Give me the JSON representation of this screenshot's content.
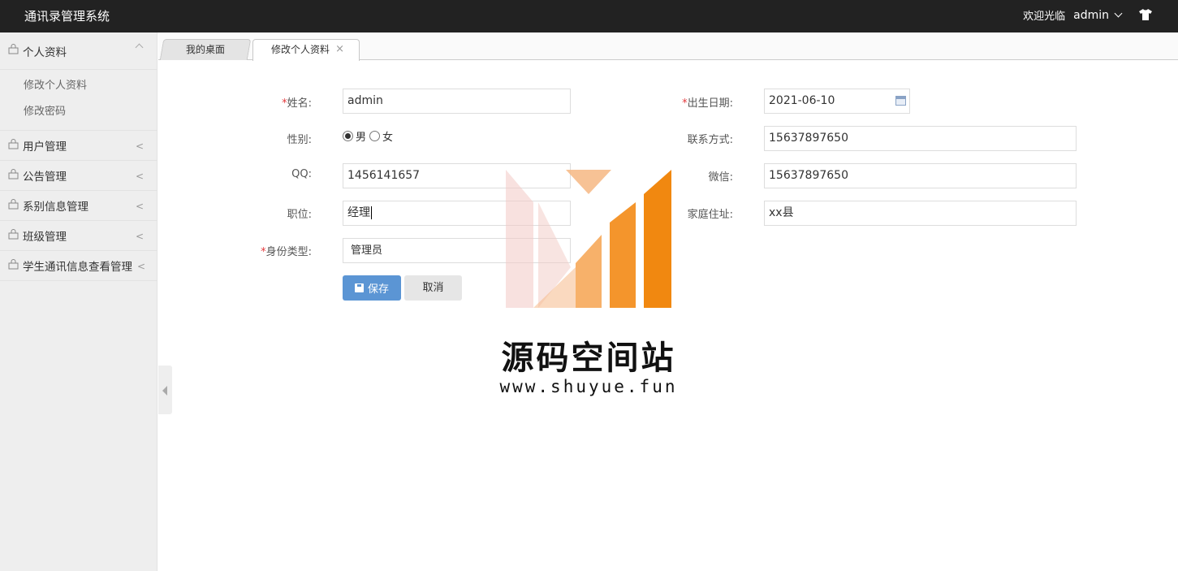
{
  "header": {
    "app_title": "通讯录管理系统",
    "welcome": "欢迎光临",
    "username": "admin"
  },
  "sidebar": {
    "items": [
      {
        "label": "个人资料",
        "expanded": true,
        "sub": [
          "修改个人资料",
          "修改密码"
        ]
      },
      {
        "label": "用户管理"
      },
      {
        "label": "公告管理"
      },
      {
        "label": "系别信息管理"
      },
      {
        "label": "班级管理"
      },
      {
        "label": "学生通讯信息查看管理"
      }
    ],
    "collapsed_arrow": "<"
  },
  "tabs": [
    {
      "label": "我的桌面"
    },
    {
      "label": "修改个人资料",
      "close": "×"
    }
  ],
  "form": {
    "required_mark": "*",
    "name_label": "姓名:",
    "name_value": "admin",
    "birth_label": "出生日期:",
    "birth_value": "2021-06-10",
    "gender_label": "性别:",
    "gender_male": "男",
    "gender_female": "女",
    "gender_selected": "男",
    "contact_label": "联系方式:",
    "contact_value": "15637897650",
    "qq_label": "QQ:",
    "qq_value": "1456141657",
    "wechat_label": "微信:",
    "wechat_value": "15637897650",
    "position_label": "职位:",
    "position_value": "经理",
    "address_label": "家庭住址:",
    "address_value": "xx县",
    "idtype_label": "身份类型:",
    "idtype_value": "管理员",
    "save_label": "保存",
    "cancel_label": "取消"
  },
  "watermark": {
    "title": "源码空间站",
    "url": "www.shuyue.fun"
  },
  "colors": {
    "header_bg": "#222222",
    "sidebar_bg": "#eeeeee",
    "primary_button": "#5b95d4",
    "required": "#e4393c",
    "watermark_orange": "#f39a2f"
  }
}
